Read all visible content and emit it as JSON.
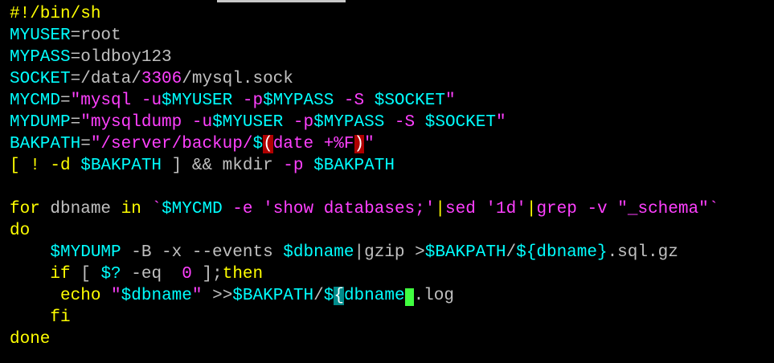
{
  "terminal": {
    "colors": {
      "background": "#000000",
      "keyword": "#ffff00",
      "variable": "#00ffff",
      "string": "#ff40ff",
      "plain": "#c0c0c0",
      "bracket_highlight_red": "#b00000",
      "bracket_highlight_cyan": "#008b8b",
      "cursor": "#40ff40"
    },
    "lines": [
      [
        {
          "t": "#!/bin/sh",
          "c": "kw"
        }
      ],
      [
        {
          "t": "MYUSER",
          "c": "var"
        },
        {
          "t": "=root",
          "c": "plain"
        }
      ],
      [
        {
          "t": "MYPASS",
          "c": "var"
        },
        {
          "t": "=oldboy123",
          "c": "plain"
        }
      ],
      [
        {
          "t": "SOCKET",
          "c": "var"
        },
        {
          "t": "=/data/",
          "c": "plain"
        },
        {
          "t": "3306",
          "c": "num"
        },
        {
          "t": "/mysql.sock",
          "c": "plain"
        }
      ],
      [
        {
          "t": "MYCMD",
          "c": "var"
        },
        {
          "t": "=",
          "c": "plain"
        },
        {
          "t": "\"mysql -u",
          "c": "str"
        },
        {
          "t": "$MYUSER",
          "c": "var"
        },
        {
          "t": " -p",
          "c": "str"
        },
        {
          "t": "$MYPASS",
          "c": "var"
        },
        {
          "t": " -S ",
          "c": "str"
        },
        {
          "t": "$SOCKET",
          "c": "var"
        },
        {
          "t": "\"",
          "c": "str"
        }
      ],
      [
        {
          "t": "MYDUMP",
          "c": "var"
        },
        {
          "t": "=",
          "c": "plain"
        },
        {
          "t": "\"mysqldump -u",
          "c": "str"
        },
        {
          "t": "$MYUSER",
          "c": "var"
        },
        {
          "t": " -p",
          "c": "str"
        },
        {
          "t": "$MYPASS",
          "c": "var"
        },
        {
          "t": " -S ",
          "c": "str"
        },
        {
          "t": "$SOCKET",
          "c": "var"
        },
        {
          "t": "\"",
          "c": "str"
        }
      ],
      [
        {
          "t": "BAKPATH",
          "c": "var"
        },
        {
          "t": "=",
          "c": "plain"
        },
        {
          "t": "\"/server/backup/",
          "c": "str"
        },
        {
          "t": "$",
          "c": "var"
        },
        {
          "t": "(",
          "c": "hl-red"
        },
        {
          "t": "date +%F",
          "c": "str"
        },
        {
          "t": ")",
          "c": "hl-red"
        },
        {
          "t": "\"",
          "c": "str"
        }
      ],
      [
        {
          "t": "[ ! -d ",
          "c": "kw"
        },
        {
          "t": "$BAKPATH",
          "c": "var"
        },
        {
          "t": " ] && mkdir ",
          "c": "plain"
        },
        {
          "t": "-p",
          "c": "str"
        },
        {
          "t": " ",
          "c": "plain"
        },
        {
          "t": "$BAKPATH",
          "c": "var"
        }
      ],
      [],
      [
        {
          "t": "for",
          "c": "kw"
        },
        {
          "t": " dbname ",
          "c": "plain"
        },
        {
          "t": "in",
          "c": "kw"
        },
        {
          "t": " `",
          "c": "str"
        },
        {
          "t": "$MYCMD",
          "c": "var"
        },
        {
          "t": " -e ",
          "c": "str"
        },
        {
          "t": "'show databases;'",
          "c": "str"
        },
        {
          "t": "|",
          "c": "kw"
        },
        {
          "t": "sed ",
          "c": "str"
        },
        {
          "t": "'1d'",
          "c": "str"
        },
        {
          "t": "|",
          "c": "kw"
        },
        {
          "t": "grep -v ",
          "c": "str"
        },
        {
          "t": "\"_schema\"",
          "c": "str"
        },
        {
          "t": "`",
          "c": "str"
        }
      ],
      [
        {
          "t": "do",
          "c": "kw"
        }
      ],
      [
        {
          "t": "    ",
          "c": "plain"
        },
        {
          "t": "$MYDUMP",
          "c": "var"
        },
        {
          "t": " -B -x --events ",
          "c": "plain"
        },
        {
          "t": "$dbname",
          "c": "var"
        },
        {
          "t": "|gzip >",
          "c": "plain"
        },
        {
          "t": "$BAKPATH",
          "c": "var"
        },
        {
          "t": "/",
          "c": "plain"
        },
        {
          "t": "${dbname}",
          "c": "var"
        },
        {
          "t": ".sql.gz",
          "c": "plain"
        }
      ],
      [
        {
          "t": "    ",
          "c": "plain"
        },
        {
          "t": "if",
          "c": "kw"
        },
        {
          "t": " [ ",
          "c": "plain"
        },
        {
          "t": "$?",
          "c": "var"
        },
        {
          "t": " -eq  ",
          "c": "plain"
        },
        {
          "t": "0",
          "c": "num"
        },
        {
          "t": " ];",
          "c": "plain"
        },
        {
          "t": "then",
          "c": "kw"
        }
      ],
      [
        {
          "t": "     ",
          "c": "plain"
        },
        {
          "t": "echo",
          "c": "kw"
        },
        {
          "t": " ",
          "c": "plain"
        },
        {
          "t": "\"",
          "c": "str"
        },
        {
          "t": "$dbname",
          "c": "var"
        },
        {
          "t": "\"",
          "c": "str"
        },
        {
          "t": " >>",
          "c": "plain"
        },
        {
          "t": "$BAKPATH",
          "c": "var"
        },
        {
          "t": "/",
          "c": "plain"
        },
        {
          "t": "$",
          "c": "var"
        },
        {
          "t": "{",
          "c": "hl-cyan"
        },
        {
          "t": "dbname",
          "c": "var"
        },
        {
          "t": "}",
          "c": "cursor"
        },
        {
          "t": ".log",
          "c": "plain"
        }
      ],
      [
        {
          "t": "    ",
          "c": "plain"
        },
        {
          "t": "fi",
          "c": "kw"
        }
      ],
      [
        {
          "t": "done",
          "c": "kw"
        }
      ]
    ]
  }
}
